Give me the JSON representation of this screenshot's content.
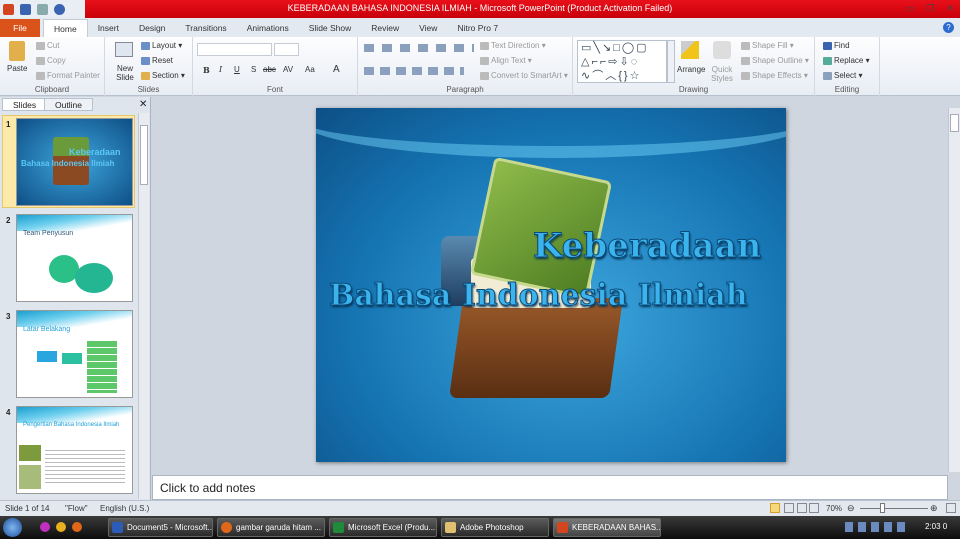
{
  "window": {
    "title": "KEBERADAAN BAHASA INDONESIA ILMIAH  -  Microsoft PowerPoint (Product Activation Failed)"
  },
  "tabs": [
    "File",
    "Home",
    "Insert",
    "Design",
    "Transitions",
    "Animations",
    "Slide Show",
    "Review",
    "View",
    "Nitro Pro 7"
  ],
  "ribbon": {
    "clipboard": {
      "label": "Clipboard",
      "paste": "Paste",
      "cut": "Cut",
      "copy": "Copy",
      "format_painter": "Format Painter"
    },
    "slides": {
      "label": "Slides",
      "new_slide": "New Slide",
      "layout": "Layout",
      "reset": "Reset",
      "section": "Section"
    },
    "font": {
      "label": "Font",
      "bold": "B",
      "italic": "I",
      "underline": "U",
      "shadow": "S",
      "strike": "abc",
      "spacing": "AV",
      "case": "Aa",
      "color": "A"
    },
    "paragraph": {
      "label": "Paragraph",
      "text_direction": "Text Direction",
      "align_text": "Align Text",
      "convert_smartart": "Convert to SmartArt"
    },
    "drawing": {
      "label": "Drawing",
      "arrange": "Arrange",
      "quick_styles": "Quick Styles",
      "shape_fill": "Shape Fill",
      "shape_outline": "Shape Outline",
      "shape_effects": "Shape Effects"
    },
    "editing": {
      "label": "Editing",
      "find": "Find",
      "replace": "Replace",
      "select": "Select"
    }
  },
  "left_pane": {
    "tabs": [
      "Slides",
      "Outline"
    ],
    "slides": [
      {
        "num": "1",
        "title_line1": "Keberadaan",
        "title_line2": "Bahasa Indonesia Ilmiah"
      },
      {
        "num": "2",
        "title": "Team Penyusun"
      },
      {
        "num": "3",
        "title": "Latar Belakang"
      },
      {
        "num": "4",
        "title": "Pengertian Bahasa Indonesia Ilmiah"
      }
    ]
  },
  "slide": {
    "line1": "Keberadaan",
    "line2": "Bahasa Indonesia Ilmiah"
  },
  "notes": {
    "placeholder": "Click to add notes"
  },
  "status": {
    "slide": "Slide 1 of 14",
    "theme": "\"Flow\"",
    "language": "English (U.S.)",
    "zoom": "70%"
  },
  "taskbar": {
    "items": [
      "Document5 - Microsoft...",
      "gambar garuda hitam ...",
      "Microsoft Excel (Produ...",
      "Adobe Photoshop",
      "KEBERADAAN BAHAS..."
    ],
    "clock": "2:03 0"
  },
  "colors": {
    "title_bar": "#d8000c",
    "file_tab": "#d9531b",
    "slide_bg": "#1a7fc0"
  }
}
